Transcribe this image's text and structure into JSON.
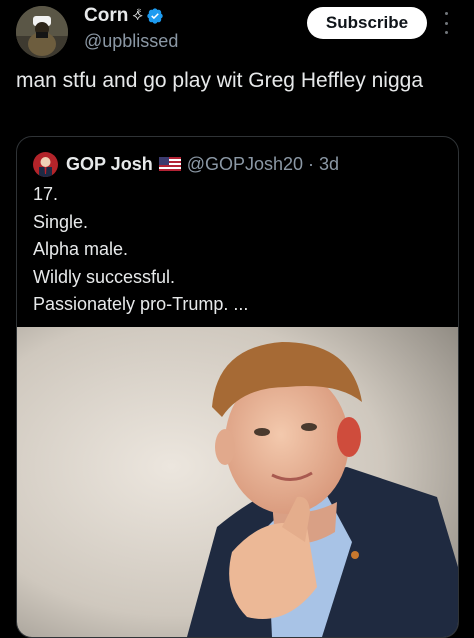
{
  "author": {
    "display_name": "Corn",
    "name_decoration": "⟡⃰",
    "handle": "@upblissed",
    "verified": true
  },
  "actions": {
    "subscribe_label": "Subscribe",
    "more_icon": "vertical-ellipsis-icon"
  },
  "tweet": {
    "text": "man stfu and go play wit Greg Heffley nigga"
  },
  "quote": {
    "display_name": "GOP Josh",
    "flag": "us-flag-emoji",
    "handle": "@GOPJosh20",
    "separator": "·",
    "time": "3d",
    "lines": [
      "17.",
      "Single.",
      "Alpha male.",
      "Wildly successful.",
      "Passionately pro-Trump. ..."
    ]
  },
  "colors": {
    "background": "#000000",
    "text_primary": "#e7e9ea",
    "text_secondary": "#8b98a5",
    "verified_blue": "#1d9bf0",
    "border": "#2f3336"
  }
}
